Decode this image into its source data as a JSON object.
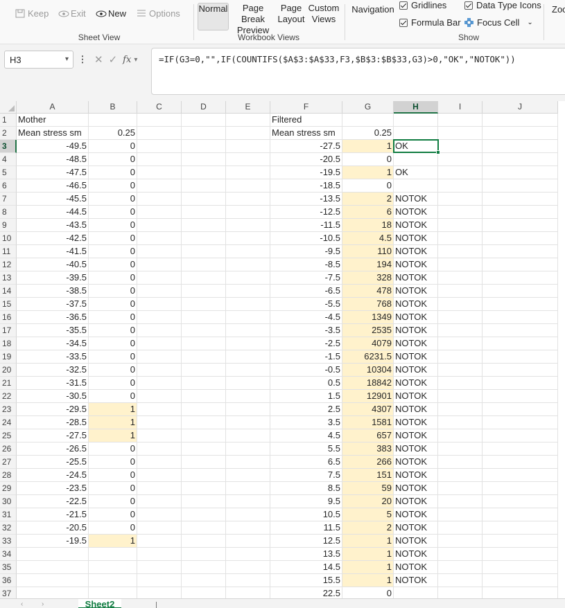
{
  "ribbon": {
    "sheet_view": {
      "label": "Sheet View",
      "keep": "Keep",
      "exit": "Exit",
      "new": "New",
      "options": "Options"
    },
    "workbook_views": {
      "label": "Workbook Views",
      "normal": "Normal",
      "page_break_1": "Page Break",
      "page_break_2": "Preview",
      "page_layout_1": "Page",
      "page_layout_2": "Layout",
      "custom_views_1": "Custom",
      "custom_views_2": "Views"
    },
    "navigation": "Navigation",
    "show": {
      "label": "Show",
      "gridlines": "Gridlines",
      "formula_bar": "Formula Bar",
      "data_type_icons": "Data Type Icons",
      "focus_cell": "Focus Cell"
    },
    "zoom_partial": "Zoo"
  },
  "formula_bar": {
    "name_box": "H3",
    "formula": "=IF(G3=0,\"\",IF(COUNTIFS($A$3:$A$33,F3,$B$3:$B$33,G3)>0,\"OK\",\"NOTOK\"))"
  },
  "columns": [
    "A",
    "B",
    "C",
    "D",
    "E",
    "F",
    "G",
    "H",
    "I",
    "J"
  ],
  "selected_column": "H",
  "selected_row": 3,
  "highlight_color": "#fff2cc",
  "rows": [
    {
      "n": "1",
      "A": "Mother",
      "B": "",
      "F": "Filtered",
      "G": "",
      "H": ""
    },
    {
      "n": "2",
      "A": "Mean stress sm",
      "B": "0.25",
      "F": "Mean stress sm",
      "G": "0.25",
      "H": ""
    },
    {
      "n": "3",
      "A": "-49.5",
      "B": "0",
      "F": "-27.5",
      "G": "1",
      "H": "OK"
    },
    {
      "n": "4",
      "A": "-48.5",
      "B": "0",
      "F": "-20.5",
      "G": "0",
      "H": ""
    },
    {
      "n": "5",
      "A": "-47.5",
      "B": "0",
      "F": "-19.5",
      "G": "1",
      "H": "OK"
    },
    {
      "n": "6",
      "A": "-46.5",
      "B": "0",
      "F": "-18.5",
      "G": "0",
      "H": ""
    },
    {
      "n": "7",
      "A": "-45.5",
      "B": "0",
      "F": "-13.5",
      "G": "2",
      "H": "NOTOK"
    },
    {
      "n": "8",
      "A": "-44.5",
      "B": "0",
      "F": "-12.5",
      "G": "6",
      "H": "NOTOK"
    },
    {
      "n": "9",
      "A": "-43.5",
      "B": "0",
      "F": "-11.5",
      "G": "18",
      "H": "NOTOK"
    },
    {
      "n": "10",
      "A": "-42.5",
      "B": "0",
      "F": "-10.5",
      "G": "4.5",
      "H": "NOTOK"
    },
    {
      "n": "11",
      "A": "-41.5",
      "B": "0",
      "F": "-9.5",
      "G": "110",
      "H": "NOTOK"
    },
    {
      "n": "12",
      "A": "-40.5",
      "B": "0",
      "F": "-8.5",
      "G": "194",
      "H": "NOTOK"
    },
    {
      "n": "13",
      "A": "-39.5",
      "B": "0",
      "F": "-7.5",
      "G": "328",
      "H": "NOTOK"
    },
    {
      "n": "14",
      "A": "-38.5",
      "B": "0",
      "F": "-6.5",
      "G": "478",
      "H": "NOTOK"
    },
    {
      "n": "15",
      "A": "-37.5",
      "B": "0",
      "F": "-5.5",
      "G": "768",
      "H": "NOTOK"
    },
    {
      "n": "16",
      "A": "-36.5",
      "B": "0",
      "F": "-4.5",
      "G": "1349",
      "H": "NOTOK"
    },
    {
      "n": "17",
      "A": "-35.5",
      "B": "0",
      "F": "-3.5",
      "G": "2535",
      "H": "NOTOK"
    },
    {
      "n": "18",
      "A": "-34.5",
      "B": "0",
      "F": "-2.5",
      "G": "4079",
      "H": "NOTOK"
    },
    {
      "n": "19",
      "A": "-33.5",
      "B": "0",
      "F": "-1.5",
      "G": "6231.5",
      "H": "NOTOK"
    },
    {
      "n": "20",
      "A": "-32.5",
      "B": "0",
      "F": "-0.5",
      "G": "10304",
      "H": "NOTOK"
    },
    {
      "n": "21",
      "A": "-31.5",
      "B": "0",
      "F": "0.5",
      "G": "18842",
      "H": "NOTOK"
    },
    {
      "n": "22",
      "A": "-30.5",
      "B": "0",
      "F": "1.5",
      "G": "12901",
      "H": "NOTOK"
    },
    {
      "n": "23",
      "A": "-29.5",
      "B": "1",
      "F": "2.5",
      "G": "4307",
      "H": "NOTOK"
    },
    {
      "n": "24",
      "A": "-28.5",
      "B": "1",
      "F": "3.5",
      "G": "1581",
      "H": "NOTOK"
    },
    {
      "n": "25",
      "A": "-27.5",
      "B": "1",
      "F": "4.5",
      "G": "657",
      "H": "NOTOK"
    },
    {
      "n": "26",
      "A": "-26.5",
      "B": "0",
      "F": "5.5",
      "G": "383",
      "H": "NOTOK"
    },
    {
      "n": "27",
      "A": "-25.5",
      "B": "0",
      "F": "6.5",
      "G": "266",
      "H": "NOTOK"
    },
    {
      "n": "28",
      "A": "-24.5",
      "B": "0",
      "F": "7.5",
      "G": "151",
      "H": "NOTOK"
    },
    {
      "n": "29",
      "A": "-23.5",
      "B": "0",
      "F": "8.5",
      "G": "59",
      "H": "NOTOK"
    },
    {
      "n": "30",
      "A": "-22.5",
      "B": "0",
      "F": "9.5",
      "G": "20",
      "H": "NOTOK"
    },
    {
      "n": "31",
      "A": "-21.5",
      "B": "0",
      "F": "10.5",
      "G": "5",
      "H": "NOTOK"
    },
    {
      "n": "32",
      "A": "-20.5",
      "B": "0",
      "F": "11.5",
      "G": "2",
      "H": "NOTOK"
    },
    {
      "n": "33",
      "A": "-19.5",
      "B": "1",
      "F": "12.5",
      "G": "1",
      "H": "NOTOK"
    },
    {
      "n": "34",
      "A": "",
      "B": "",
      "F": "13.5",
      "G": "1",
      "H": "NOTOK"
    },
    {
      "n": "35",
      "A": "",
      "B": "",
      "F": "14.5",
      "G": "1",
      "H": "NOTOK"
    },
    {
      "n": "36",
      "A": "",
      "B": "",
      "F": "15.5",
      "G": "1",
      "H": "NOTOK"
    },
    {
      "n": "37",
      "A": "",
      "B": "",
      "F": "22.5",
      "G": "0",
      "H": ""
    }
  ],
  "highlighted_b_rows": [
    "23",
    "24",
    "25",
    "33"
  ],
  "sheet_tab": "Sheet2"
}
